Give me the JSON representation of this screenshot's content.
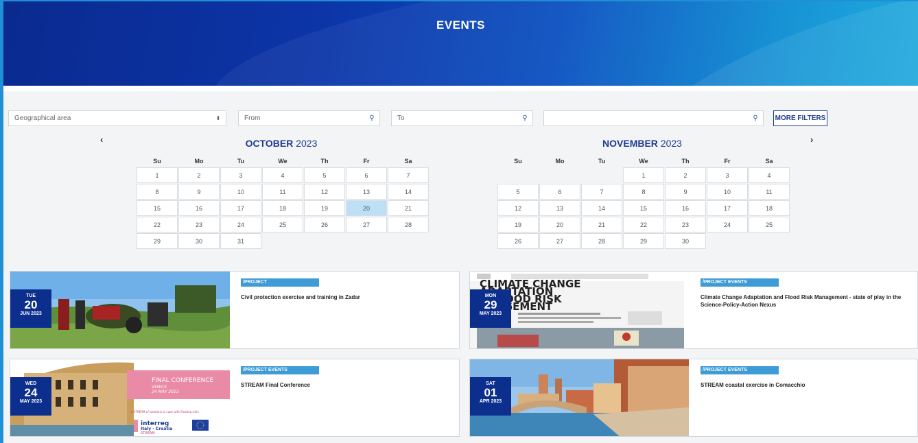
{
  "header": {
    "title": "EVENTS"
  },
  "filters": {
    "geo_label": "Geographical area",
    "geo_arrow": "⬍",
    "from_placeholder": "From",
    "to_placeholder": "To",
    "search_value": "",
    "search_icon": "⚲",
    "more_label": "MORE FILTERS"
  },
  "nav": {
    "prev": "‹",
    "next": "›"
  },
  "calendars": [
    {
      "month": "OCTOBER",
      "year": "2023",
      "dow": [
        "Su",
        "Mo",
        "Tu",
        "We",
        "Th",
        "Fr",
        "Sa"
      ],
      "weeks": [
        [
          "1",
          "2",
          "3",
          "4",
          "5",
          "6",
          "7"
        ],
        [
          "8",
          "9",
          "10",
          "11",
          "12",
          "13",
          "14"
        ],
        [
          "15",
          "16",
          "17",
          "18",
          "19",
          "20",
          "21"
        ],
        [
          "22",
          "23",
          "24",
          "25",
          "26",
          "27",
          "28"
        ],
        [
          "29",
          "30",
          "31",
          "",
          "",
          "",
          ""
        ]
      ],
      "selected": "20"
    },
    {
      "month": "NOVEMBER",
      "year": "2023",
      "dow": [
        "Su",
        "Mo",
        "Tu",
        "We",
        "Th",
        "Fr",
        "Sa"
      ],
      "weeks": [
        [
          "",
          "",
          "",
          "1",
          "2",
          "3",
          "4"
        ],
        [
          "5",
          "6",
          "7",
          "8",
          "9",
          "10",
          "11"
        ],
        [
          "12",
          "13",
          "14",
          "15",
          "16",
          "17",
          "18"
        ],
        [
          "19",
          "20",
          "21",
          "22",
          "23",
          "24",
          "25"
        ],
        [
          "26",
          "27",
          "28",
          "29",
          "30",
          "",
          ""
        ]
      ],
      "selected": ""
    }
  ],
  "events": [
    {
      "weekday": "TUE",
      "day": "20",
      "monthyear": "JUN 2023",
      "tag": "/PROJECT",
      "title": "Civil protection exercise and training in Zadar"
    },
    {
      "weekday": "MON",
      "day": "29",
      "monthyear": "MAY 2023",
      "tag": "/PROJECT EVENTS",
      "title": "Climate Change Adaptation and Flood Risk Management - state of play in the Science-Policy-Action Nexus",
      "poster": [
        "CLIMATE CHANGE",
        "ADAPTATION",
        "D FLOOD RISK",
        "ANAGEMENT"
      ]
    },
    {
      "weekday": "WED",
      "day": "24",
      "monthyear": "MAY 2023",
      "tag": "/PROJECT EVENTS",
      "title": "STREAM Final Conference",
      "poster": {
        "headline": "FINAL CONFERENCE",
        "place": "VENICE",
        "date": "24 MAY 2023",
        "slogan": "A STREAM of solutions to cope with flooding risks",
        "brand": "interreg",
        "program": "Italy - Croatia",
        "project": "STREAM"
      }
    },
    {
      "weekday": "SAT",
      "day": "01",
      "monthyear": "APR 2023",
      "tag": "/PROJECT EVENTS",
      "title": "STREAM coastal exercise in Comacchio"
    }
  ],
  "colors": {
    "accent": "#1d3b8f",
    "tag": "#3d9bd6",
    "selected_day": "#bde0f6",
    "hero_start": "#0a2a8f",
    "hero_end": "#14a6dc"
  }
}
